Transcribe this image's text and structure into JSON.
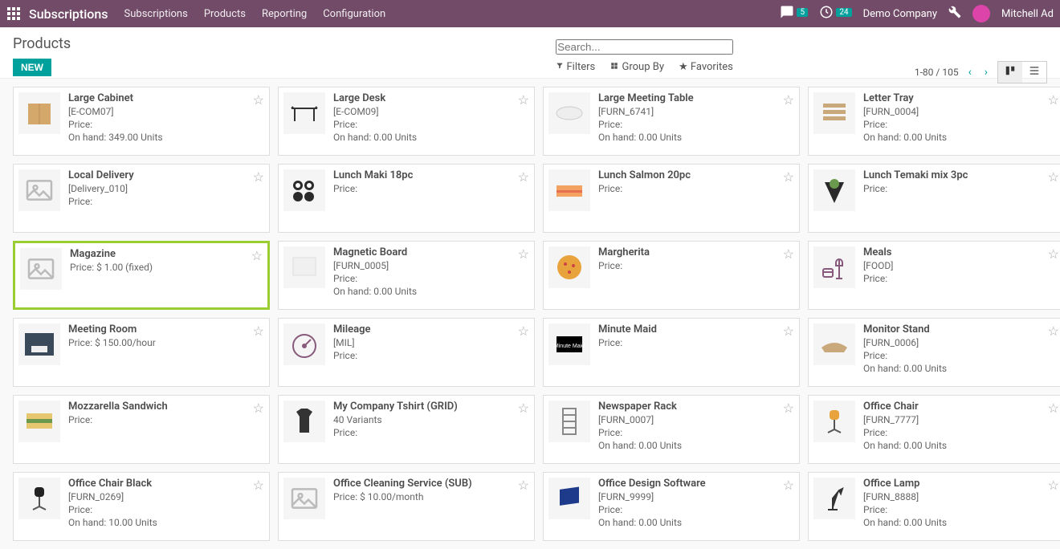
{
  "nav": {
    "brand": "Subscriptions",
    "menu": [
      "Subscriptions",
      "Products",
      "Reporting",
      "Configuration"
    ],
    "messages_count": "5",
    "activities_count": "24",
    "company": "Demo Company",
    "user": "Mitchell Ad"
  },
  "header": {
    "title": "Products",
    "new_label": "NEW",
    "search_placeholder": "Search...",
    "filters_label": "Filters",
    "groupby_label": "Group By",
    "favorites_label": "Favorites",
    "pager": "1-80 / 105"
  },
  "products": [
    {
      "name": "Large Cabinet",
      "sku": "[E-COM07]",
      "price": "Price:",
      "onhand": "On hand: 349.00 Units",
      "thumb": "cabinet"
    },
    {
      "name": "Large Desk",
      "sku": "[E-COM09]",
      "price": "Price:",
      "onhand": "On hand: 0.00 Units",
      "thumb": "desk"
    },
    {
      "name": "Large Meeting Table",
      "sku": "[FURN_6741]",
      "price": "Price:",
      "onhand": "On hand: 0.00 Units",
      "thumb": "table"
    },
    {
      "name": "Letter Tray",
      "sku": "[FURN_0004]",
      "price": "Price:",
      "onhand": "On hand: 0.00 Units",
      "thumb": "tray"
    },
    {
      "name": "Local Delivery",
      "sku": "[Delivery_010]",
      "price": "Price:",
      "onhand": "",
      "thumb": "placeholder"
    },
    {
      "name": "Lunch Maki 18pc",
      "sku": "",
      "price": "Price:",
      "onhand": "",
      "thumb": "maki"
    },
    {
      "name": "Lunch Salmon 20pc",
      "sku": "",
      "price": "Price:",
      "onhand": "",
      "thumb": "salmon"
    },
    {
      "name": "Lunch Temaki mix 3pc",
      "sku": "",
      "price": "Price:",
      "onhand": "",
      "thumb": "temaki"
    },
    {
      "name": "Magazine",
      "sku": "",
      "price": "Price: $ 1.00 (fixed)",
      "onhand": "",
      "thumb": "placeholder",
      "highlight": true
    },
    {
      "name": "Magnetic Board",
      "sku": "[FURN_0005]",
      "price": "Price:",
      "onhand": "On hand: 0.00 Units",
      "thumb": "board"
    },
    {
      "name": "Margherita",
      "sku": "",
      "price": "Price:",
      "onhand": "",
      "thumb": "pizza"
    },
    {
      "name": "Meals",
      "sku": "[FOOD]",
      "price": "Price:",
      "onhand": "",
      "thumb": "meals"
    },
    {
      "name": "Meeting Room",
      "sku": "",
      "price": "Price: $ 150.00/hour",
      "onhand": "",
      "thumb": "room"
    },
    {
      "name": "Mileage",
      "sku": "[MIL]",
      "price": "Price:",
      "onhand": "",
      "thumb": "gauge"
    },
    {
      "name": "Minute Maid",
      "sku": "",
      "price": "Price:",
      "onhand": "",
      "thumb": "minutemaid"
    },
    {
      "name": "Monitor Stand",
      "sku": "[FURN_0006]",
      "price": "Price:",
      "onhand": "On hand: 0.00 Units",
      "thumb": "stand"
    },
    {
      "name": "Mozzarella Sandwich",
      "sku": "",
      "price": "Price:",
      "onhand": "",
      "thumb": "sandwich"
    },
    {
      "name": "My Company Tshirt (GRID)",
      "sku": "",
      "price": "Price:",
      "onhand": "",
      "variants": "40 Variants",
      "thumb": "tshirt"
    },
    {
      "name": "Newspaper Rack",
      "sku": "[FURN_0007]",
      "price": "Price:",
      "onhand": "On hand: 0.00 Units",
      "thumb": "rack"
    },
    {
      "name": "Office Chair",
      "sku": "[FURN_7777]",
      "price": "Price:",
      "onhand": "On hand: 0.00 Units",
      "thumb": "chair"
    },
    {
      "name": "Office Chair Black",
      "sku": "[FURN_0269]",
      "price": "Price:",
      "onhand": "On hand: 10.00 Units",
      "thumb": "chairblack"
    },
    {
      "name": "Office Cleaning Service (SUB)",
      "sku": "",
      "price": "Price: $ 10.00/month",
      "onhand": "",
      "thumb": "placeholder"
    },
    {
      "name": "Office Design Software",
      "sku": "[FURN_9999]",
      "price": "Price:",
      "onhand": "On hand: 0.00 Units",
      "thumb": "software"
    },
    {
      "name": "Office Lamp",
      "sku": "[FURN_8888]",
      "price": "Price:",
      "onhand": "On hand: 0.00 Units",
      "thumb": "lamp"
    }
  ]
}
